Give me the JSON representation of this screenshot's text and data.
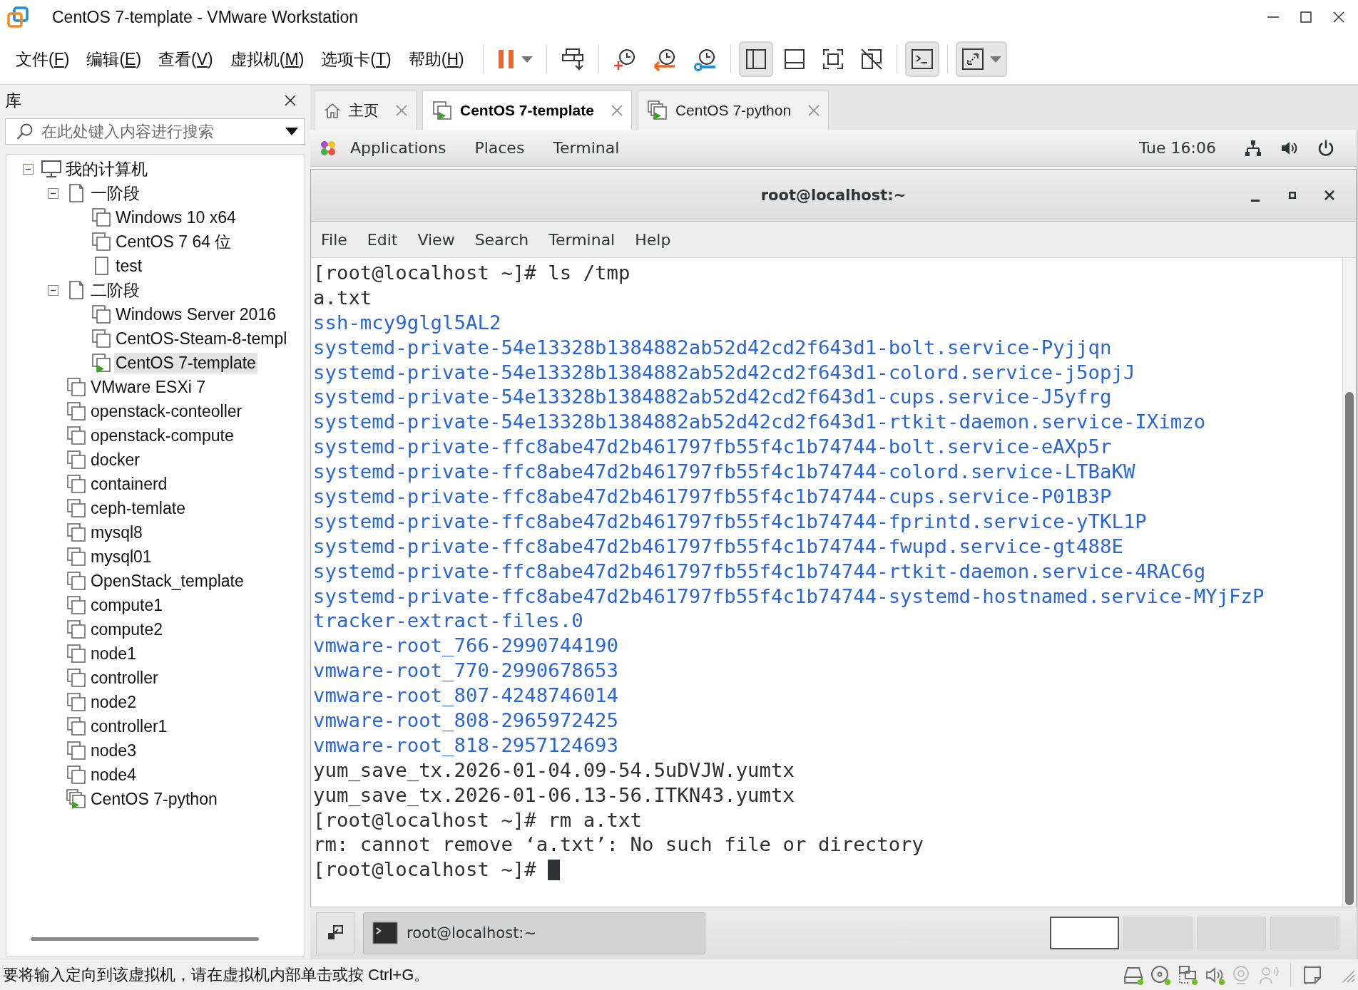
{
  "window": {
    "title": "CentOS 7-template - VMware Workstation"
  },
  "menu": [
    {
      "parts": [
        "文件(",
        "F",
        ")"
      ]
    },
    {
      "parts": [
        "编辑(",
        "E",
        ")"
      ]
    },
    {
      "parts": [
        "查看(",
        "V",
        ")"
      ]
    },
    {
      "parts": [
        "虚拟机(",
        "M",
        ")"
      ]
    },
    {
      "parts": [
        "选项卡(",
        "T",
        ")"
      ]
    },
    {
      "parts": [
        "帮助(",
        "H",
        ")"
      ]
    }
  ],
  "toolbar": [
    [
      {
        "kind": "pause",
        "selected": false,
        "dropdown": true
      }
    ],
    [
      {
        "kind": "send-keys",
        "selected": false,
        "dropdown": false
      }
    ],
    [
      {
        "kind": "take-snapshot",
        "selected": false,
        "dropdown": false
      },
      {
        "kind": "revert-snapshot",
        "selected": false,
        "dropdown": false
      },
      {
        "kind": "snapshot-manager",
        "selected": false,
        "dropdown": false
      }
    ],
    [
      {
        "kind": "library",
        "selected": true,
        "dropdown": false
      },
      {
        "kind": "thumbnails",
        "selected": false,
        "dropdown": false
      },
      {
        "kind": "full-screen",
        "selected": false,
        "dropdown": false
      },
      {
        "kind": "unity",
        "selected": false,
        "dropdown": false
      }
    ],
    [
      {
        "kind": "console",
        "selected": true,
        "dropdown": false
      }
    ],
    [
      {
        "kind": "stretch",
        "selected": true,
        "dropdown": true
      }
    ]
  ],
  "sidebar": {
    "title": "库",
    "search": {
      "placeholder": "在此处键入内容进行搜索"
    },
    "tree": [
      {
        "label": "我的计算机",
        "kind": "computer",
        "expanded": true,
        "selected": false,
        "children": [
          {
            "label": "一阶段",
            "kind": "folder",
            "expanded": true,
            "selected": false,
            "children": [
              {
                "label": "Windows 10 x64",
                "kind": "vm",
                "running": false,
                "selected": false
              },
              {
                "label": "CentOS 7 64 位",
                "kind": "vm",
                "running": false,
                "selected": false
              },
              {
                "label": "test",
                "kind": "file",
                "selected": false
              }
            ]
          },
          {
            "label": "二阶段",
            "kind": "folder",
            "expanded": true,
            "selected": false,
            "children": [
              {
                "label": "Windows Server 2016",
                "kind": "vm",
                "running": false,
                "selected": false
              },
              {
                "label": "CentOS-Steam-8-templ",
                "kind": "vm",
                "running": false,
                "selected": false
              },
              {
                "label": "CentOS 7-template",
                "kind": "vm",
                "running": true,
                "selected": true
              }
            ]
          },
          {
            "label": "VMware ESXi 7",
            "kind": "vm",
            "running": false,
            "selected": false
          },
          {
            "label": "openstack-conteoller",
            "kind": "vm",
            "running": false,
            "selected": false
          },
          {
            "label": "openstack-compute",
            "kind": "vm",
            "running": false,
            "selected": false
          },
          {
            "label": "docker",
            "kind": "vm",
            "running": false,
            "selected": false
          },
          {
            "label": "containerd",
            "kind": "vm",
            "running": false,
            "selected": false
          },
          {
            "label": "ceph-temlate",
            "kind": "vm",
            "running": false,
            "selected": false
          },
          {
            "label": "mysql8",
            "kind": "vm",
            "running": false,
            "selected": false
          },
          {
            "label": "mysql01",
            "kind": "vm",
            "running": false,
            "selected": false
          },
          {
            "label": "OpenStack_template",
            "kind": "vm",
            "running": false,
            "selected": false
          },
          {
            "label": "compute1",
            "kind": "vm",
            "running": false,
            "selected": false
          },
          {
            "label": "compute2",
            "kind": "vm",
            "running": false,
            "selected": false
          },
          {
            "label": "node1",
            "kind": "vm",
            "running": false,
            "selected": false
          },
          {
            "label": "controller",
            "kind": "vm",
            "running": false,
            "selected": false
          },
          {
            "label": "node2",
            "kind": "vm",
            "running": false,
            "selected": false
          },
          {
            "label": "controller1",
            "kind": "vm",
            "running": false,
            "selected": false
          },
          {
            "label": "node3",
            "kind": "vm",
            "running": false,
            "selected": false
          },
          {
            "label": "node4",
            "kind": "vm",
            "running": false,
            "selected": false
          },
          {
            "label": "CentOS 7-python",
            "kind": "group",
            "running": true,
            "selected": false
          }
        ]
      }
    ]
  },
  "tabs": [
    {
      "label": "主页",
      "kind": "home",
      "selected": false
    },
    {
      "label": "CentOS 7-template",
      "kind": "vm",
      "running": true,
      "selected": true
    },
    {
      "label": "CentOS 7-python",
      "kind": "group",
      "running": true,
      "selected": false
    }
  ],
  "guest": {
    "top_bar": {
      "menus": [
        "Applications",
        "Places",
        "Terminal"
      ],
      "clock": "Tue 16:06"
    },
    "terminal": {
      "title": "root@localhost:~",
      "menu": [
        "File",
        "Edit",
        "View",
        "Search",
        "Terminal",
        "Help"
      ],
      "cursor": true,
      "lines": [
        {
          "text": "[root@localhost ~]# ls /tmp",
          "color": "#303030"
        },
        {
          "text": "a.txt",
          "color": "#303030"
        },
        {
          "text": "ssh-mcy9glgl5AL2",
          "color": "#2b66d9"
        },
        {
          "text": "systemd-private-54e13328b1384882ab52d42cd2f643d1-bolt.service-Pyjjqn",
          "color": "#2b66d9"
        },
        {
          "text": "systemd-private-54e13328b1384882ab52d42cd2f643d1-colord.service-j5opjJ",
          "color": "#2b66d9"
        },
        {
          "text": "systemd-private-54e13328b1384882ab52d42cd2f643d1-cups.service-J5yfrg",
          "color": "#2b66d9"
        },
        {
          "text": "systemd-private-54e13328b1384882ab52d42cd2f643d1-rtkit-daemon.service-IXimzo",
          "color": "#2b66d9"
        },
        {
          "text": "systemd-private-ffc8abe47d2b461797fb55f4c1b74744-bolt.service-eAXp5r",
          "color": "#2b66d9"
        },
        {
          "text": "systemd-private-ffc8abe47d2b461797fb55f4c1b74744-colord.service-LTBaKW",
          "color": "#2b66d9"
        },
        {
          "text": "systemd-private-ffc8abe47d2b461797fb55f4c1b74744-cups.service-P01B3P",
          "color": "#2b66d9"
        },
        {
          "text": "systemd-private-ffc8abe47d2b461797fb55f4c1b74744-fprintd.service-yTKL1P",
          "color": "#2b66d9"
        },
        {
          "text": "systemd-private-ffc8abe47d2b461797fb55f4c1b74744-fwupd.service-gt488E",
          "color": "#2b66d9"
        },
        {
          "text": "systemd-private-ffc8abe47d2b461797fb55f4c1b74744-rtkit-daemon.service-4RAC6g",
          "color": "#2b66d9"
        },
        {
          "text": "systemd-private-ffc8abe47d2b461797fb55f4c1b74744-systemd-hostnamed.service-MYjFzP",
          "color": "#2b66d9"
        },
        {
          "text": "tracker-extract-files.0",
          "color": "#2b66d9"
        },
        {
          "text": "vmware-root_766-2990744190",
          "color": "#2b66d9"
        },
        {
          "text": "vmware-root_770-2990678653",
          "color": "#2b66d9"
        },
        {
          "text": "vmware-root_807-4248746014",
          "color": "#2b66d9"
        },
        {
          "text": "vmware-root_808-2965972425",
          "color": "#2b66d9"
        },
        {
          "text": "vmware-root_818-2957124693",
          "color": "#2b66d9"
        },
        {
          "text": "yum_save_tx.2026-01-04.09-54.5uDVJW.yumtx",
          "color": "#303030"
        },
        {
          "text": "yum_save_tx.2026-01-06.13-56.ITKN43.yumtx",
          "color": "#303030"
        },
        {
          "text": "[root@localhost ~]# rm a.txt",
          "color": "#303030"
        },
        {
          "text": "rm: cannot remove ‘a.txt’: No such file or directory",
          "color": "#303030"
        },
        {
          "text": "[root@localhost ~]#",
          "color": "#303030"
        }
      ]
    },
    "bottom_panel": {
      "windows": [
        {
          "label": "root@localhost:~"
        }
      ],
      "workspaces": [
        {
          "selected": true
        },
        {
          "selected": false
        },
        {
          "selected": false
        },
        {
          "selected": false
        }
      ]
    }
  },
  "status_bar": {
    "message": "要将输入定向到该虚拟机，请在虚拟机内部单击或按 Ctrl+G。",
    "devices": [
      {
        "kind": "hard-disk",
        "connected": true
      },
      {
        "kind": "cd",
        "connected": true
      },
      {
        "kind": "network",
        "connected": true
      },
      {
        "kind": "sound",
        "connected": true
      },
      {
        "kind": "camera",
        "connected": false
      },
      {
        "kind": "voice",
        "connected": false
      }
    ]
  }
}
